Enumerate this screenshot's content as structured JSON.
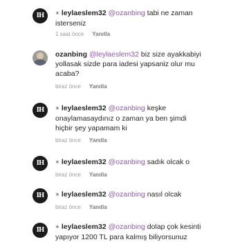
{
  "comments": [
    {
      "username": "leylaeslem32",
      "badge_icon": "star-icon",
      "mention": "@ozanbing",
      "line1": " tabi ne zaman",
      "line2": "isterseniz",
      "line3": "",
      "time": "1 saat önce",
      "reply_label": "Yanıtla"
    },
    {
      "username": "ozanbing",
      "mention": "@leylaeslem32",
      "line1": " biz size ayakkabiyi",
      "line2": "yollasak sizde para iadesi yapsaniz olur mu",
      "line3": "acaba?",
      "time": "biraz önce",
      "reply_label": "Yanıtla"
    },
    {
      "username": "leylaeslem32",
      "badge_icon": "star-icon",
      "mention": "@ozanbing",
      "line1": " keşke",
      "line2": "onaylamasaydınız o zaman ya ben şimdi",
      "line3": "hiçbir şey yapamam ki",
      "time": "biraz önce",
      "reply_label": "Yanıtla"
    },
    {
      "username": "leylaeslem32",
      "badge_icon": "star-icon",
      "mention": "@ozanbing",
      "line1": " sadık olcak o",
      "line2": "",
      "line3": "",
      "time": "biraz önce",
      "reply_label": "Yanıtla"
    },
    {
      "username": "leylaeslem32",
      "badge_icon": "star-icon",
      "mention": "@ozanbing",
      "line1": " nasıl olcak",
      "line2": "",
      "line3": "",
      "time": "biraz önce",
      "reply_label": "Yanıtla"
    },
    {
      "username": "leylaeslem32",
      "badge_icon": "star-icon",
      "mention": "@ozanbing",
      "line1": " dolap çok kesinti",
      "line2": "yapıyor 1200 TL para kalmış biliyorsunuz",
      "line3": "",
      "time": "",
      "reply_label": ""
    }
  ],
  "avatar_monogram": "IH",
  "colors": {
    "mention": "#8e59a6",
    "meta": "#9a9a9a",
    "text": "#262626"
  }
}
